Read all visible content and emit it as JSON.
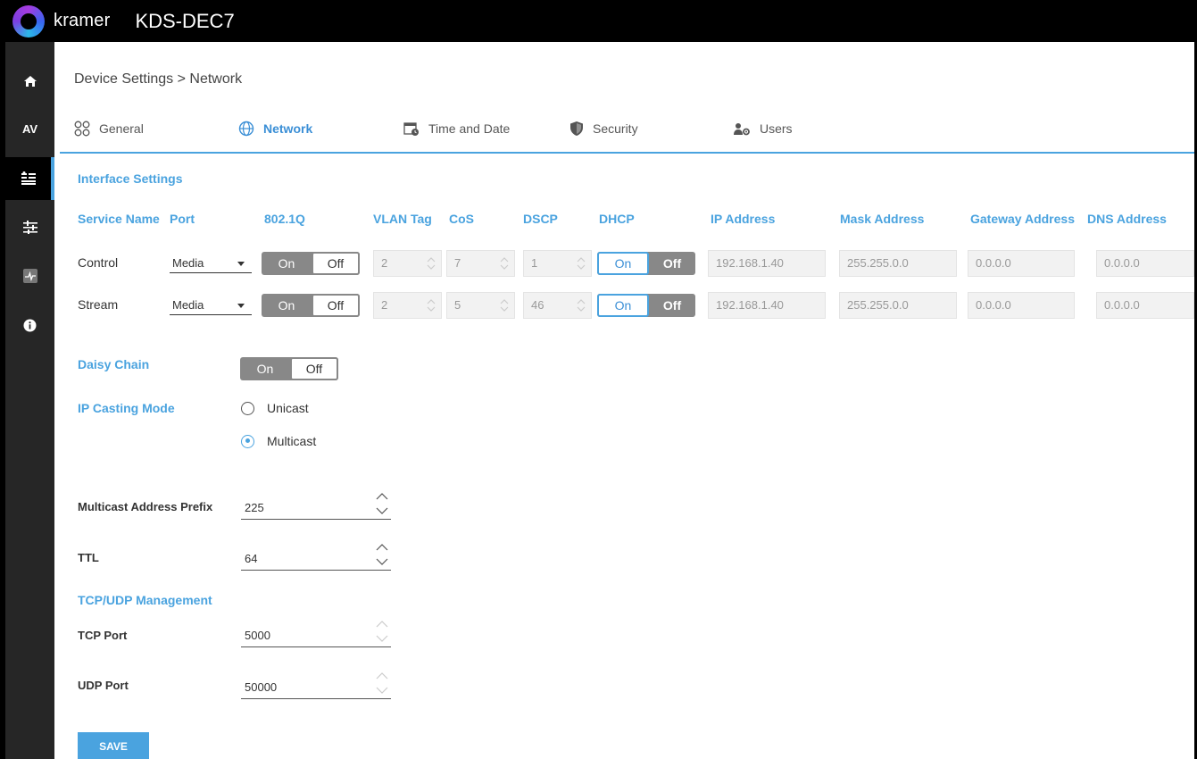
{
  "header": {
    "brand": "kramer",
    "device": "KDS-DEC7"
  },
  "sidebar": {
    "items": [
      {
        "icon": "home-icon"
      },
      {
        "label": "AV"
      },
      {
        "icon": "device-settings-icon"
      },
      {
        "icon": "sliders-icon"
      },
      {
        "icon": "diagnostics-icon"
      },
      {
        "icon": "info-icon"
      }
    ]
  },
  "breadcrumb": "Device Settings > Network",
  "tabs": [
    {
      "label": "General"
    },
    {
      "label": "Network",
      "active": true
    },
    {
      "label": "Time and Date"
    },
    {
      "label": "Security"
    },
    {
      "label": "Users"
    }
  ],
  "interface": {
    "title": "Interface Settings",
    "columns": [
      "Service Name",
      "Port",
      "802.1Q",
      "VLAN Tag",
      "CoS",
      "DSCP",
      "DHCP",
      "IP Address",
      "Mask Address",
      "Gateway Address",
      "DNS Address"
    ],
    "rows": [
      {
        "service": "Control",
        "port": "Media",
        "q_on": "On",
        "q_off": "Off",
        "vlan": "2",
        "cos": "7",
        "dscp": "1",
        "dhcp_on": "On",
        "dhcp_off": "Off",
        "ip": "192.168.1.40",
        "mask": "255.255.0.0",
        "gateway": "0.0.0.0",
        "dns": "0.0.0.0"
      },
      {
        "service": "Stream",
        "port": "Media",
        "q_on": "On",
        "q_off": "Off",
        "vlan": "2",
        "cos": "5",
        "dscp": "46",
        "dhcp_on": "On",
        "dhcp_off": "Off",
        "ip": "192.168.1.40",
        "mask": "255.255.0.0",
        "gateway": "0.0.0.0",
        "dns": "0.0.0.0"
      }
    ]
  },
  "daisy_chain": {
    "label": "Daisy Chain",
    "on": "On",
    "off": "Off"
  },
  "ip_casting": {
    "label": "IP Casting Mode",
    "options": [
      "Unicast",
      "Multicast"
    ],
    "selected": "Multicast"
  },
  "multicast_prefix": {
    "label": "Multicast Address Prefix",
    "value": "225"
  },
  "ttl": {
    "label": "TTL",
    "value": "64"
  },
  "tcp_udp": {
    "title": "TCP/UDP Management"
  },
  "tcp_port": {
    "label": "TCP Port",
    "value": "5000"
  },
  "udp_port": {
    "label": "UDP Port",
    "value": "50000"
  },
  "save_label": "SAVE",
  "colors": {
    "accent": "#4aa3df",
    "sidebar": "#262626",
    "topbar": "#000000"
  }
}
